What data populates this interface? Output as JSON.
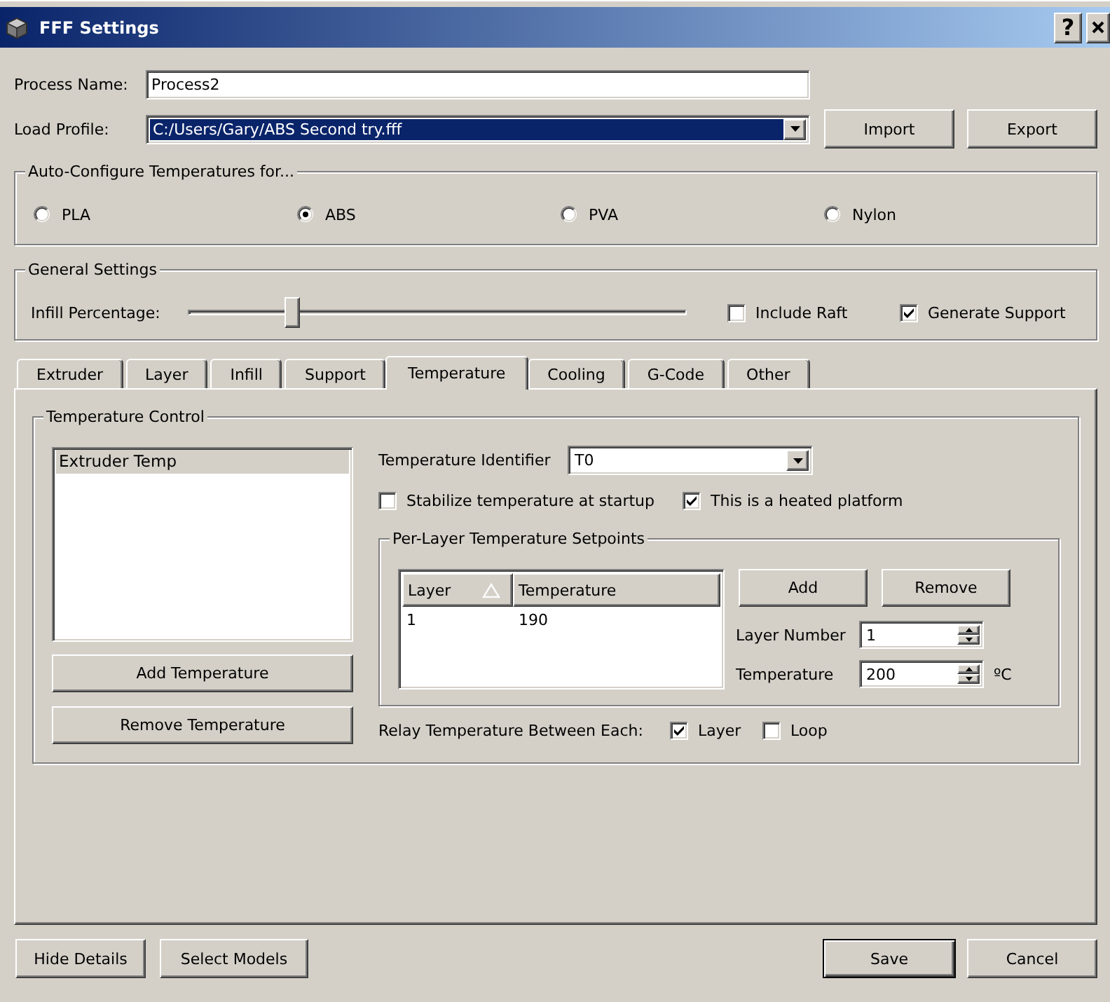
{
  "window": {
    "title": "FFF Settings",
    "help_button": "?"
  },
  "process_name": {
    "label": "Process Name:",
    "value": "Process2"
  },
  "load_profile": {
    "label": "Load Profile:",
    "value": "C:/Users/Gary/ABS Second try.fff",
    "focused": true
  },
  "profile_buttons": [
    "Import",
    "Export"
  ],
  "auto_configure": {
    "title": "Auto-Configure Temperatures for...",
    "options": [
      {
        "label": "PLA",
        "selected": false
      },
      {
        "label": "ABS",
        "selected": true
      },
      {
        "label": "PVA",
        "selected": false
      },
      {
        "label": "Nylon",
        "selected": false
      }
    ]
  },
  "general_settings": {
    "title": "General Settings",
    "infill": {
      "label": "Infill Percentage:",
      "level": 0.2
    },
    "checkboxes": [
      {
        "label": "Include Raft",
        "checked": false
      },
      {
        "label": "Generate Support",
        "checked": true
      }
    ]
  },
  "tabs": [
    {
      "label": "Extruder",
      "selected": false
    },
    {
      "label": "Layer",
      "selected": false
    },
    {
      "label": "Infill",
      "selected": false
    },
    {
      "label": "Support",
      "selected": false
    },
    {
      "label": "Temperature",
      "selected": true
    },
    {
      "label": "Cooling",
      "selected": false
    },
    {
      "label": "G-Code",
      "selected": false
    },
    {
      "label": "Other",
      "selected": false
    }
  ],
  "temperature_control": {
    "title": "Temperature Control",
    "list": [
      {
        "label": "Extruder Temp",
        "selected": true
      }
    ],
    "buttons": [
      "Add Temperature",
      "Remove Temperature"
    ],
    "identifier": {
      "label": "Temperature Identifier",
      "value": "T0"
    },
    "options": [
      {
        "label": "Stabilize temperature at startup",
        "checked": false
      },
      {
        "label": "This is a heated platform",
        "checked": true
      }
    ],
    "setpoints": {
      "title": "Per-Layer Temperature Setpoints",
      "table": {
        "columns": [
          {
            "label": "Layer",
            "sorted": true
          },
          {
            "label": "Temperature",
            "sorted": false
          }
        ],
        "rows": [
          [
            "1",
            "190"
          ]
        ]
      },
      "buttons": [
        "Add",
        "Remove"
      ],
      "layer_number": {
        "label": "Layer Number",
        "value": "1"
      },
      "temperature": {
        "label": "Temperature",
        "value": "200",
        "unit": "ºC"
      }
    },
    "relay": {
      "label": "Relay Temperature Between Each:",
      "options": [
        {
          "label": "Layer",
          "checked": true
        },
        {
          "label": "Loop",
          "checked": false
        }
      ]
    }
  },
  "footer": {
    "left_buttons": [
      "Hide Details",
      "Select Models"
    ],
    "right_buttons": [
      {
        "label": "Save",
        "default": true
      },
      {
        "label": "Cancel",
        "default": false
      }
    ]
  }
}
